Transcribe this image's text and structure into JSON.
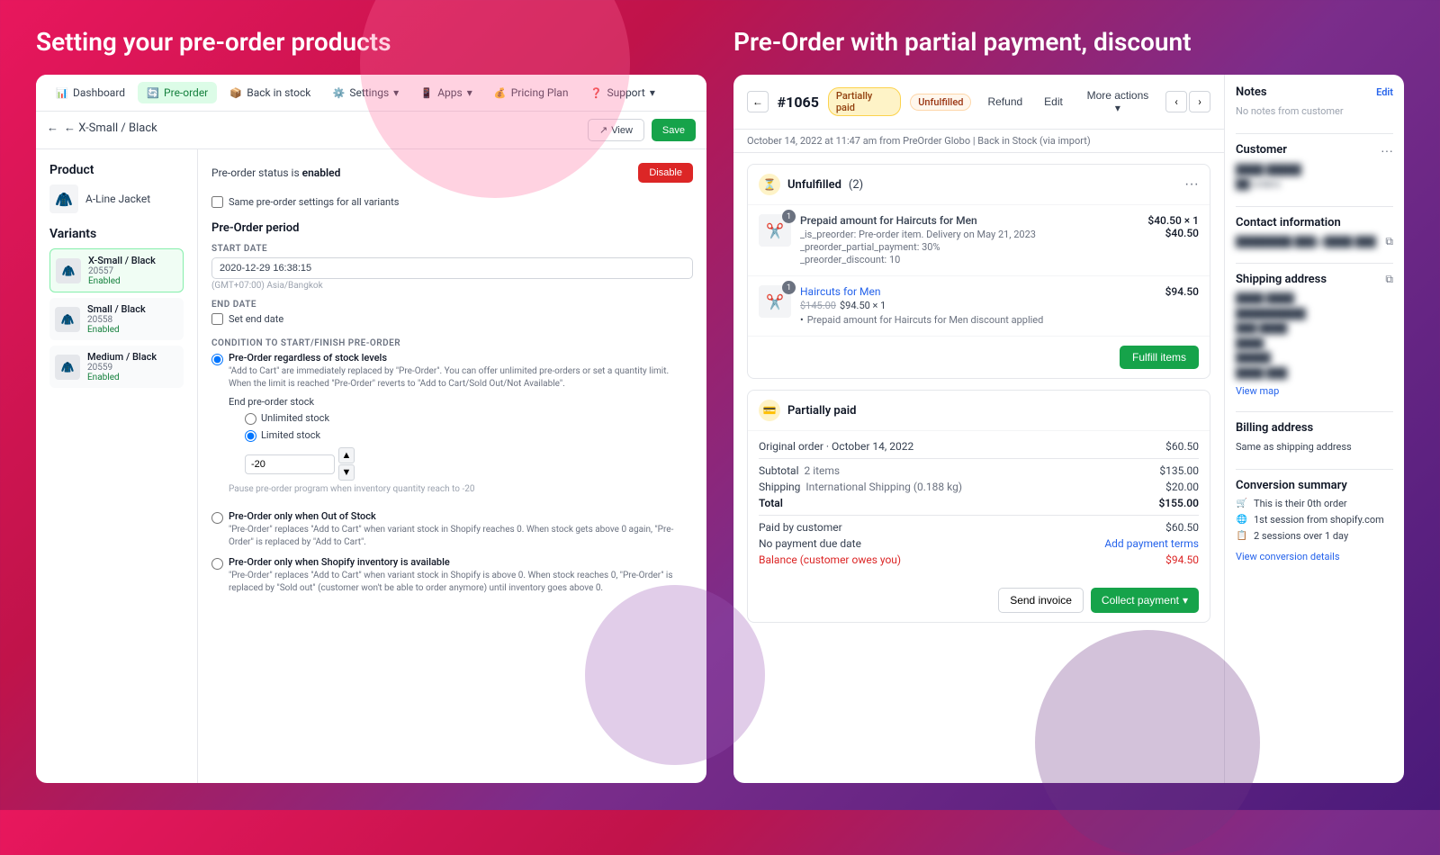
{
  "background": {
    "gradient": "linear-gradient(135deg, #e8175d 0%, #c0134a 30%, #7b2d8b 60%, #4a1a7a 100%)"
  },
  "left_panel": {
    "title": "Setting your pre-order products",
    "nav": {
      "items": [
        {
          "id": "dashboard",
          "label": "Dashboard",
          "icon": "📊",
          "active": false
        },
        {
          "id": "pre-order",
          "label": "Pre-order",
          "icon": "🔄",
          "active": true
        },
        {
          "id": "back-in-stock",
          "label": "Back in stock",
          "icon": "📦",
          "active": false
        },
        {
          "id": "settings",
          "label": "Settings",
          "icon": "⚙️",
          "active": false
        },
        {
          "id": "apps",
          "label": "Apps",
          "icon": "📱",
          "active": false
        },
        {
          "id": "pricing-plan",
          "label": "Pricing Plan",
          "icon": "💰",
          "active": false
        },
        {
          "id": "support",
          "label": "Support",
          "icon": "❓",
          "active": false
        }
      ]
    },
    "product_header": {
      "back_label": "← X-Small / Black",
      "view_label": "View",
      "save_label": "Save"
    },
    "product": {
      "section_label": "Product",
      "name": "A-Line Jacket",
      "icon": "🧥"
    },
    "variants": {
      "section_label": "Variants",
      "items": [
        {
          "name": "X-Small / Black",
          "id": "20557",
          "status": "Enabled"
        },
        {
          "name": "Small / Black",
          "id": "20558",
          "status": "Enabled"
        },
        {
          "name": "Medium / Black",
          "id": "20559",
          "status": "Enabled"
        }
      ]
    },
    "settings": {
      "status_text": "Pre-order status is",
      "status_value": "enabled",
      "disable_label": "Disable",
      "same_settings_label": "Same pre-order settings for all variants",
      "period_title": "Pre-Order period",
      "start_date_label": "START DATE",
      "start_date_value": "2020-12-29 16:38:15",
      "timezone_label": "(GMT+07:00) Asia/Bangkok",
      "end_date_label": "END DATE",
      "set_end_date_label": "Set end date",
      "condition_title": "CONDITION TO START/FINISH PRE-ORDER",
      "options": [
        {
          "id": "opt1",
          "label": "Pre-Order regardless of stock levels",
          "desc": "\"Add to Cart\" are immediately replaced by \"Pre-Order\". You can offer unlimited pre-orders or set a quantity limit. When the limit is reached \"Pre-Order\" reverts to \"Add to Cart/Sold Out/Not Available\".",
          "selected": true,
          "sub_options": {
            "end_pre_order_label": "End pre-order stock",
            "items": [
              {
                "id": "unlimited",
                "label": "Unlimited stock",
                "selected": false
              },
              {
                "id": "limited",
                "label": "Limited stock",
                "selected": true
              }
            ],
            "stock_value": "-20",
            "stock_help": "Pause pre-order program when inventory quantity reach to -20"
          }
        },
        {
          "id": "opt2",
          "label": "Pre-Order only when Out of Stock",
          "desc": "\"Pre-Order\" replaces \"Add to Cart\" when variant stock in Shopify reaches 0. When stock gets above 0 again, \"Pre-Order\" is replaced by \"Add to Cart\".",
          "selected": false
        },
        {
          "id": "opt3",
          "label": "Pre-Order only when Shopify inventory is available",
          "desc": "\"Pre-Order\" replaces \"Add to Cart\" when variant stock in Shopify is above 0. When stock reaches 0, \"Pre-Order\" is replaced by \"Sold out\" (customer won't be able to order anymore) until inventory goes above 0.",
          "selected": false
        }
      ]
    }
  },
  "right_panel": {
    "title": "Pre-Order with partial payment, discount",
    "order": {
      "number": "#1065",
      "badges": [
        {
          "label": "Partially paid",
          "type": "yellow"
        },
        {
          "label": "Unfulfilled",
          "type": "orange"
        }
      ],
      "header_actions": [
        "Refund",
        "Edit",
        "More actions"
      ],
      "sub_text": "October 14, 2022 at 11:47 am from PreOrder Globo | Back in Stock (via import)",
      "fulfillment": {
        "title": "Unfulfilled",
        "count": "(2)",
        "items": [
          {
            "name": "Prepaid amount for Haircuts for Men",
            "price_qty": "$40.50 × 1",
            "total": "$40.50",
            "meta": [
              "_is_preorder: Pre-order item. Delivery on May 21, 2023",
              "_preorder_partial_payment: 30%",
              "_preorder_discount: 10"
            ],
            "qty": "1"
          },
          {
            "name": "Haircuts for Men",
            "original_price": "$145.00",
            "price": "$94.50",
            "qty_price": "$94.50 × 1",
            "total": "$94.50",
            "meta": [
              "Prepaid amount for Haircuts for Men discount applied"
            ],
            "qty": "1",
            "is_link": true
          }
        ],
        "fulfill_btn": "Fulfill items"
      },
      "payment": {
        "title": "Partially paid",
        "original_order_label": "Original order",
        "original_order_date": "October 14, 2022",
        "original_order_amount": "$60.50",
        "subtotal_label": "Subtotal",
        "subtotal_items": "2 items",
        "subtotal_amount": "$135.00",
        "shipping_label": "Shipping",
        "shipping_detail": "International Shipping (0.188 kg)",
        "shipping_amount": "$20.00",
        "total_label": "Total",
        "total_amount": "$155.00",
        "paid_label": "Paid by customer",
        "paid_amount": "$60.50",
        "no_payment_label": "No payment due date",
        "add_payment_label": "Add payment terms",
        "balance_label": "Balance (customer owes you)",
        "balance_amount": "$94.50",
        "send_invoice_label": "Send invoice",
        "collect_label": "Collect payment"
      },
      "sidebar": {
        "notes": {
          "title": "Notes",
          "edit_label": "Edit",
          "value": "No notes from customer"
        },
        "customer": {
          "title": "Customer",
          "name_blurred": "████ █████",
          "orders_blurred": "██ orders"
        },
        "contact": {
          "title": "Contact information",
          "email_blurred": "████████.███@████.███"
        },
        "shipping": {
          "title": "Shipping address",
          "lines": [
            "██████ ██████",
            "██████████",
            "███████ ████",
            "████",
            "█████",
            "█ ███ ███-████"
          ],
          "view_map": "View map"
        },
        "billing": {
          "title": "Billing address",
          "value": "Same as shipping address"
        },
        "conversion": {
          "title": "Conversion summary",
          "items": [
            {
              "icon": "🛒",
              "text": "This is their 0th order"
            },
            {
              "icon": "🌐",
              "text": "1st session from shopify.com"
            },
            {
              "icon": "📋",
              "text": "2 sessions over 1 day"
            }
          ],
          "link": "View conversion details"
        }
      }
    }
  }
}
